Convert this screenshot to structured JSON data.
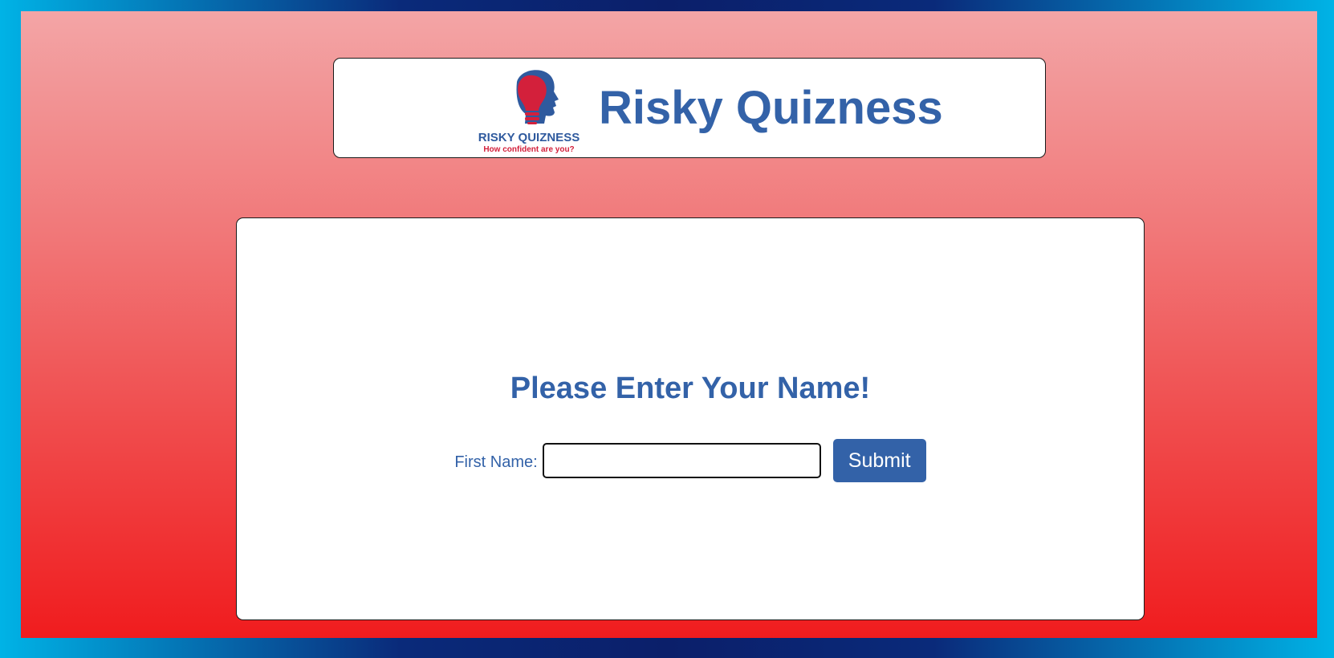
{
  "header": {
    "title": "Risky Quizness",
    "logo": {
      "wordmark": "RISKY QUIZNESS",
      "tagline": "How confident are you?"
    }
  },
  "main": {
    "heading": "Please Enter Your Name!",
    "form": {
      "label": "First Name:",
      "input_value": "",
      "submit_label": "Submit"
    }
  },
  "colors": {
    "brand_blue": "#3362a8",
    "logo_red": "#d3203b",
    "background_top": "#f3a5a6",
    "background_bottom": "#f01c1e"
  },
  "icons": {
    "logo": "head-lightbulb-icon"
  }
}
